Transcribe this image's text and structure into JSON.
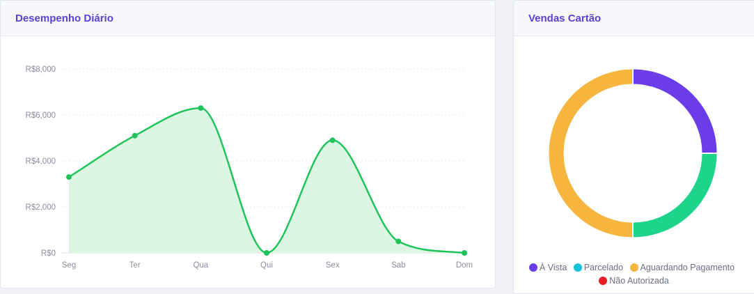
{
  "daily_card": {
    "title": "Desempenho Diário"
  },
  "sales_card": {
    "title": "Vendas Cartão"
  },
  "chart_data": [
    {
      "type": "area",
      "title": "Desempenho Diário",
      "categories": [
        "Seg",
        "Ter",
        "Qua",
        "Qui",
        "Sex",
        "Sab",
        "Dom"
      ],
      "values": [
        3300,
        5100,
        6300,
        0,
        4900,
        500,
        0
      ],
      "ylim": [
        0,
        8000
      ],
      "yticks": [
        0,
        2000,
        4000,
        6000,
        8000
      ],
      "ytick_labels": [
        "R$0",
        "R$2,000",
        "R$4,000",
        "R$6,000",
        "R$8,000"
      ],
      "grid": true,
      "colors": {
        "line": "#1ec45a",
        "fill": "#ddf6e4"
      }
    },
    {
      "type": "pie",
      "title": "Vendas Cartão",
      "categories": [
        "À Vista",
        "Parcelado",
        "Aguardando Pagamento",
        "Não Autorizada"
      ],
      "values": [
        25,
        0,
        50,
        0
      ],
      "extra_values": [
        {
          "label": "green segment",
          "value": 25
        }
      ],
      "colors": [
        "#6a3de8",
        "#17c1d9",
        "#f6b53f",
        "#ea1f25"
      ],
      "legend": "bottom"
    }
  ]
}
